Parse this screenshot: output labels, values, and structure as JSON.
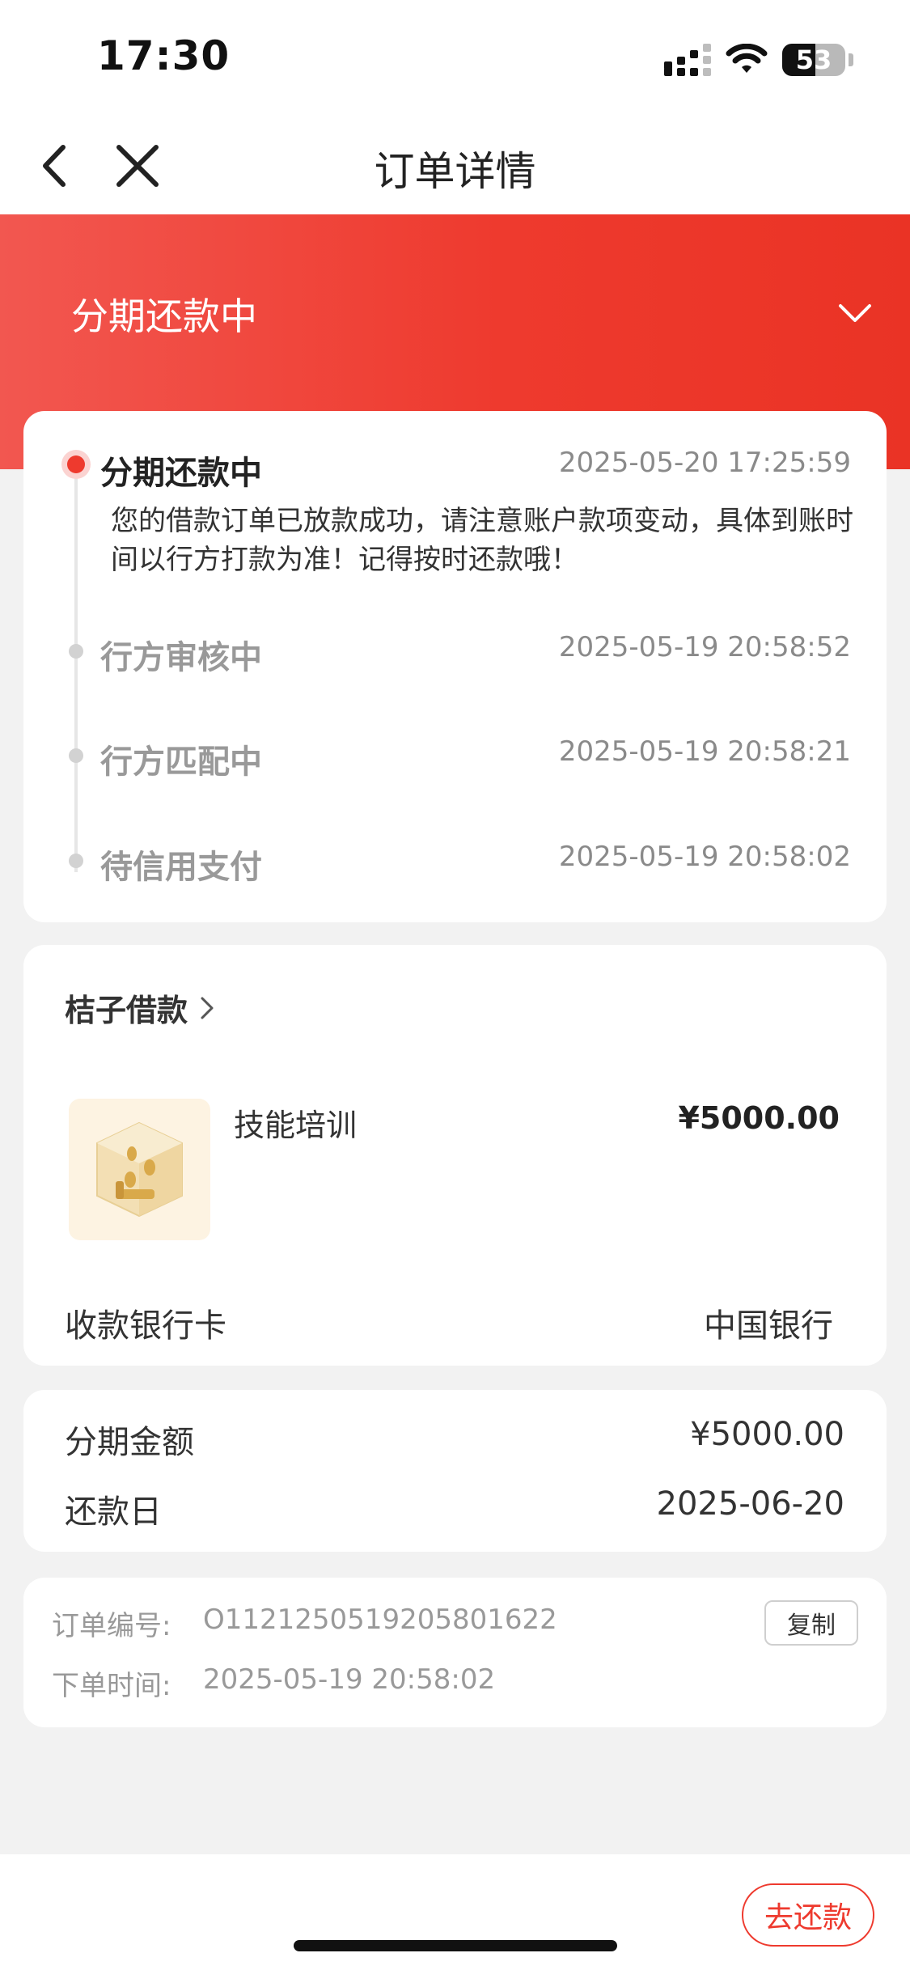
{
  "status_bar": {
    "time": "17:30",
    "battery": "53",
    "battery_level": 0.53,
    "icons": [
      "signal-icon",
      "wifi-icon",
      "battery-icon"
    ]
  },
  "nav": {
    "title": "订单详情",
    "icons": [
      "back-icon",
      "close-icon"
    ]
  },
  "banner": {
    "status": "分期还款中"
  },
  "timeline": [
    {
      "title": "分期还款中",
      "time": "2025-05-20 17:25:59",
      "desc": "您的借款订单已放款成功，请注意账户款项变动，具体到账时间以行方打款为准！记得按时还款哦！"
    },
    {
      "title": "行方审核中",
      "time": "2025-05-19 20:58:52"
    },
    {
      "title": "行方匹配中",
      "time": "2025-05-19 20:58:21"
    },
    {
      "title": "待信用支付",
      "time": "2025-05-19 20:58:02"
    }
  ],
  "product": {
    "merchant": "桔子借款",
    "name": "技能培训",
    "price": "¥5000.00",
    "bank_card_label": "收款银行卡",
    "bank_card_value": "中国银行"
  },
  "installment": {
    "amount_label": "分期金额",
    "amount_value": "¥5000.00",
    "due_label": "还款日",
    "due_value": "2025-06-20"
  },
  "order": {
    "number_label": "订单编号:",
    "number_value": "O1121250519205801622",
    "copy_label": "复制",
    "time_label": "下单时间:",
    "time_value": "2025-05-19 20:58:02"
  },
  "footer": {
    "pay_label": "去还款"
  },
  "colors": {
    "accent": "#ee3a2e",
    "banner_start": "#f25750",
    "banner_end": "#ea3325"
  }
}
